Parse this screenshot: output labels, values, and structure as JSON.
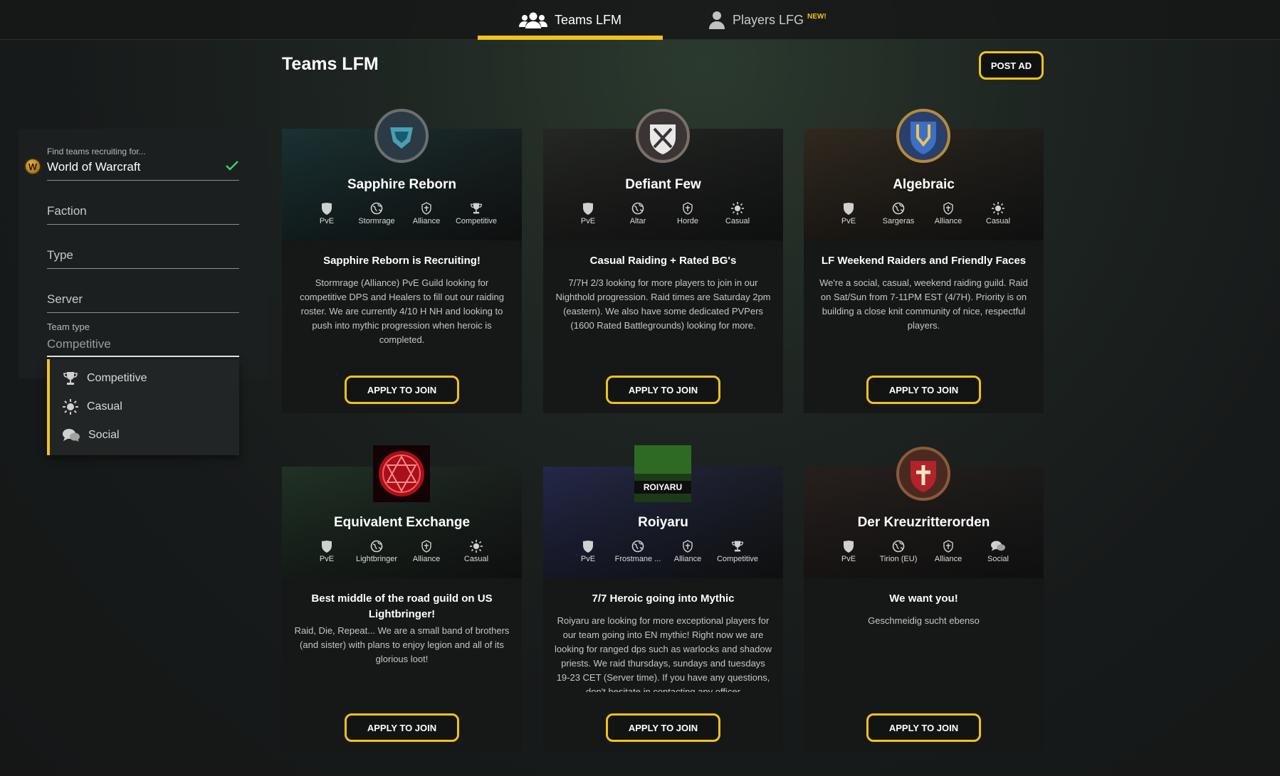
{
  "nav": {
    "tabs": [
      {
        "label": "Teams LFM"
      },
      {
        "label": "Players LFG",
        "badge": "NEW!"
      }
    ]
  },
  "page": {
    "title": "Teams LFM",
    "post_ad_label": "POST AD"
  },
  "filters": {
    "game_label": "Find teams recruiting for...",
    "game_value": "World of Warcraft",
    "faction_placeholder": "Faction",
    "type_placeholder": "Type",
    "server_placeholder": "Server",
    "team_type_label": "Team type",
    "team_type_value": "Competitive",
    "team_type_options": [
      {
        "label": "Competitive",
        "icon": "trophy-icon"
      },
      {
        "label": "Casual",
        "icon": "sun-icon"
      },
      {
        "label": "Social",
        "icon": "chat-bubbles-icon"
      }
    ]
  },
  "apply_label": "APPLY TO JOIN",
  "cards": [
    {
      "name": "Sapphire Reborn",
      "stats": [
        "PvE",
        "Stormrage",
        "Alliance",
        "Competitive"
      ],
      "heading": "Sapphire Reborn is Recruiting!",
      "description": "Stormrage (Alliance) PvE Guild looking for competitive DPS and Healers to fill out our raiding roster. We are currently 4/10 H NH and looking to push into mythic progression when heroic is completed.",
      "banner_color": "#1f3a3c"
    },
    {
      "name": "Defiant Few",
      "stats": [
        "PvE",
        "Altar",
        "Horde",
        "Casual"
      ],
      "heading": "Casual Raiding + Rated BG's",
      "description": "7/7H 2/3 looking for more players to join in our Nighthold progression. Raid times are Saturday 2pm (eastern). We also have some dedicated PVPers (1600 Rated Battlegrounds) looking for more.",
      "banner_color": "#2c2e2a"
    },
    {
      "name": "Algebraic",
      "stats": [
        "PvE",
        "Sargeras",
        "Alliance",
        "Casual"
      ],
      "heading": "LF Weekend Raiders and Friendly Faces",
      "description": "We're a social, casual, weekend raiding guild. Raid on Sat/Sun from 7-11PM EST (4/7H). Priority is on building a close knit community of nice, respectful players.",
      "banner_color": "#3a3024"
    },
    {
      "name": "Equivalent Exchange",
      "stats": [
        "PvE",
        "Lightbringer",
        "Alliance",
        "Casual"
      ],
      "heading": "Best middle of the road guild on US Lightbringer!",
      "description": "Raid, Die, Repeat... We are a small band of brothers (and sister) with plans to enjoy legion and all of its glorious loot!",
      "banner_color": "#263a2c"
    },
    {
      "name": "Roiyaru",
      "stats": [
        "PvE",
        "Frostmane ...",
        "Alliance",
        "Competitive"
      ],
      "heading": "7/7 Heroic going into Mythic",
      "description": "Roiyaru are looking for more exceptional players for our team going into EN mythic! Right now we are looking for ranged dps such as warlocks and shadow priests. We raid thursdays, sundays and tuesdays 19-23 CET (Server time). If you have any questions, don't hesitate in contacting any officer",
      "banner_color": "#2a2f55",
      "emblem_text": "ROIYARU"
    },
    {
      "name": "Der Kreuzritterorden",
      "stats": [
        "PvE",
        "Tirion (EU)",
        "Alliance",
        "Social"
      ],
      "heading": "We want you!",
      "description": "Geschmeidig sucht ebenso",
      "banner_color": "#2e2522"
    }
  ],
  "colors": {
    "accent": "#f2c21a",
    "check": "#3fcf6a"
  }
}
